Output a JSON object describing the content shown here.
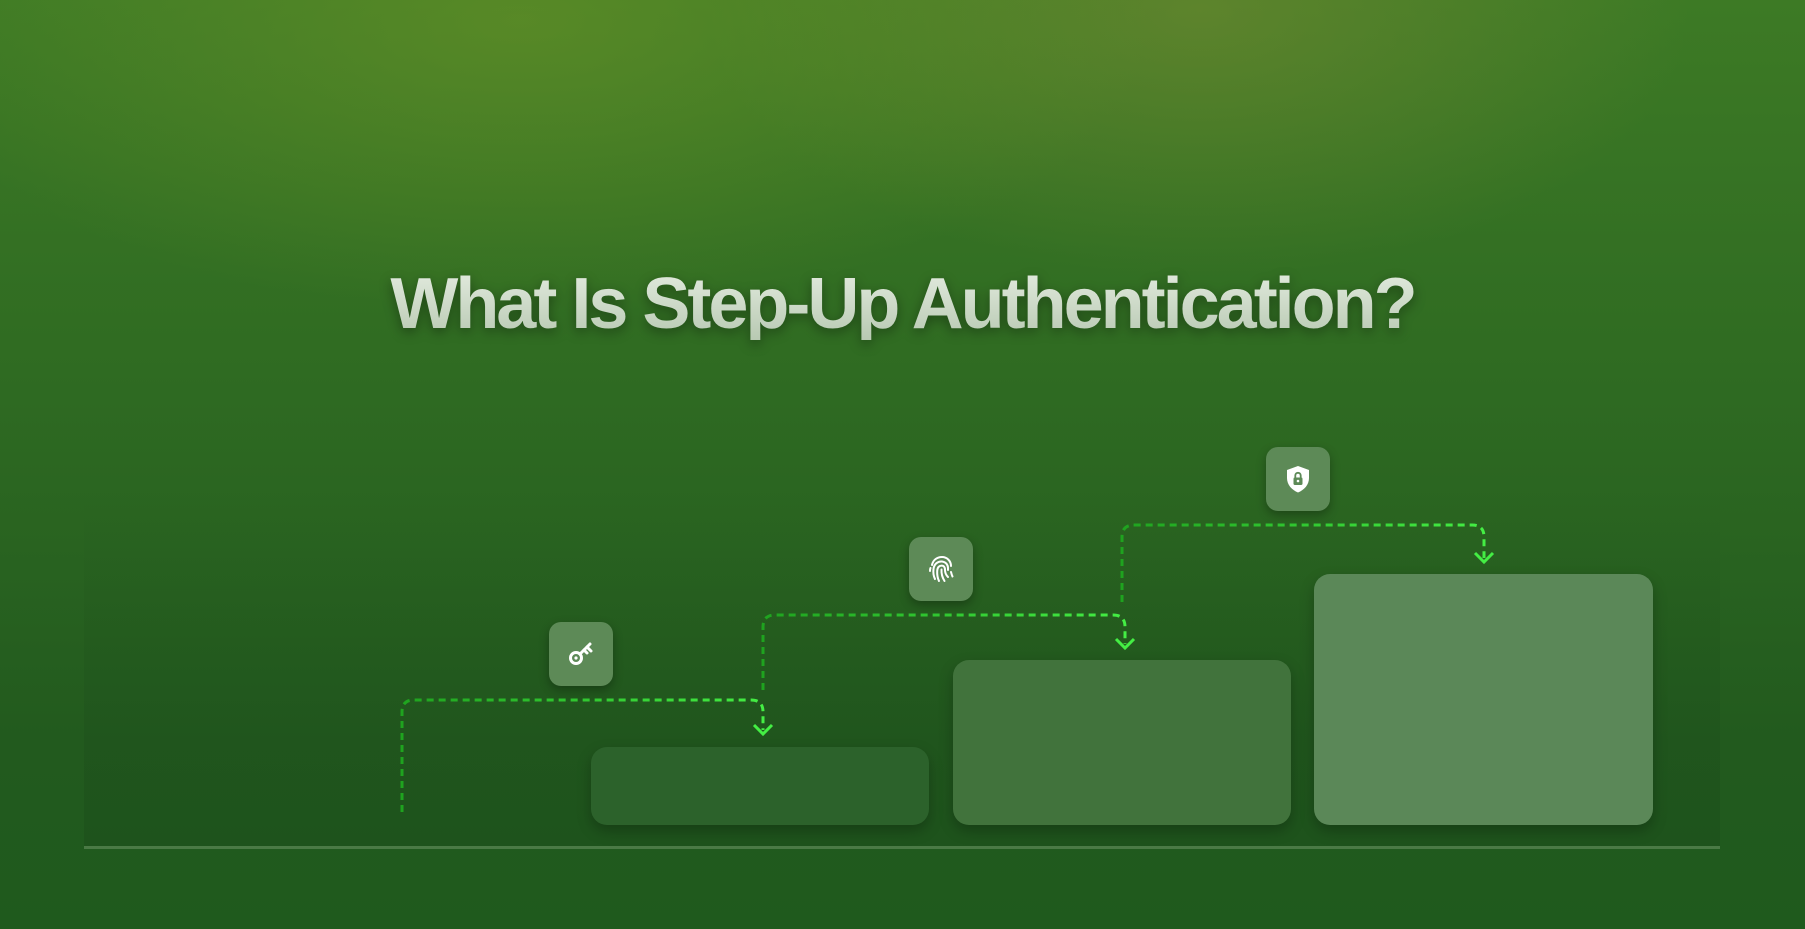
{
  "title": "What Is Step-Up Authentication?",
  "colors": {
    "connector_dark": "#1fa31f",
    "connector_bright": "#44ee44"
  },
  "steps": [
    {
      "icon": "key-icon"
    },
    {
      "icon": "fingerprint-icon"
    },
    {
      "icon": "shield-lock-icon"
    }
  ]
}
